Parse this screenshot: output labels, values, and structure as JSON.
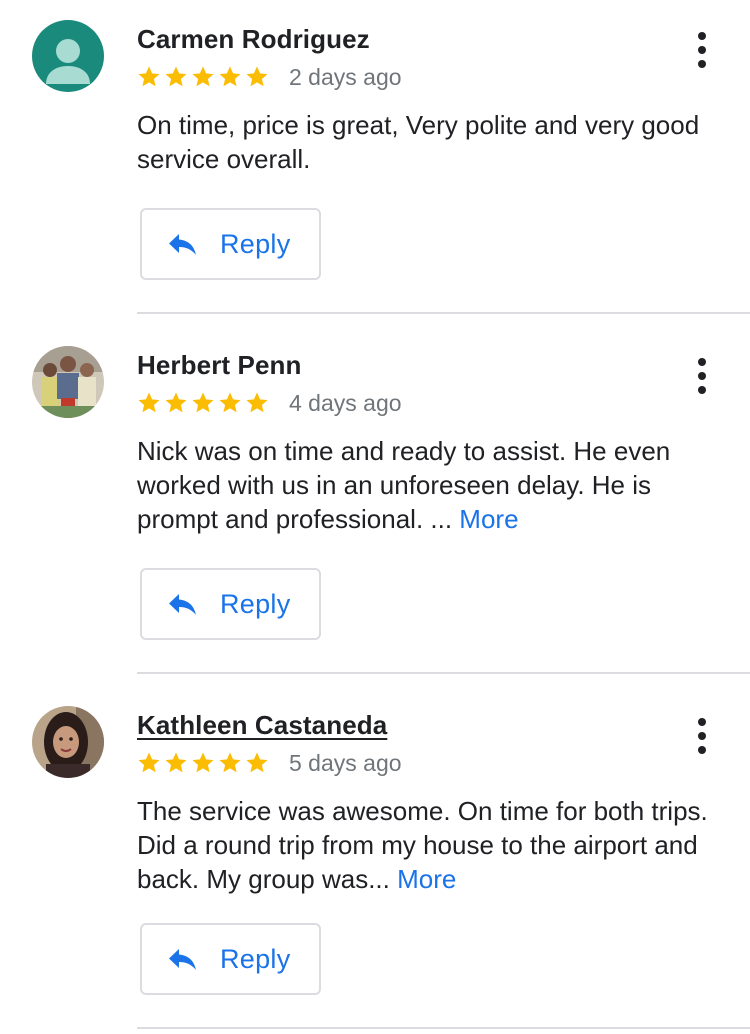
{
  "colors": {
    "star": "#fbbc04",
    "link": "#1a73e8",
    "meta_text": "#70757a",
    "divider": "#dadce0",
    "default_avatar_bg": "#1a8a7c"
  },
  "reviews": [
    {
      "author": "Carmen Rodriguez",
      "avatar_icon": "default-person-avatar-icon",
      "rating": 5,
      "date": "2 days ago",
      "text": "On time, price is great, Very polite and very good service overall.",
      "more_label": "",
      "reply_label": "Reply"
    },
    {
      "author": "Herbert Penn",
      "avatar_icon": "group-photo-avatar",
      "rating": 5,
      "date": "4 days ago",
      "text": "Nick was on time and ready to assist. He even worked with us in an unforeseen delay. He is prompt and professional. ... ",
      "more_label": "More",
      "reply_label": "Reply"
    },
    {
      "author": "Kathleen Castaneda",
      "avatar_icon": "portrait-photo-avatar",
      "rating": 5,
      "date": "5 days ago",
      "text": "The service was awesome. On time for both trips. Did a round trip from my house to the airport and back. My group was... ",
      "more_label": "More",
      "reply_label": "Reply"
    }
  ]
}
